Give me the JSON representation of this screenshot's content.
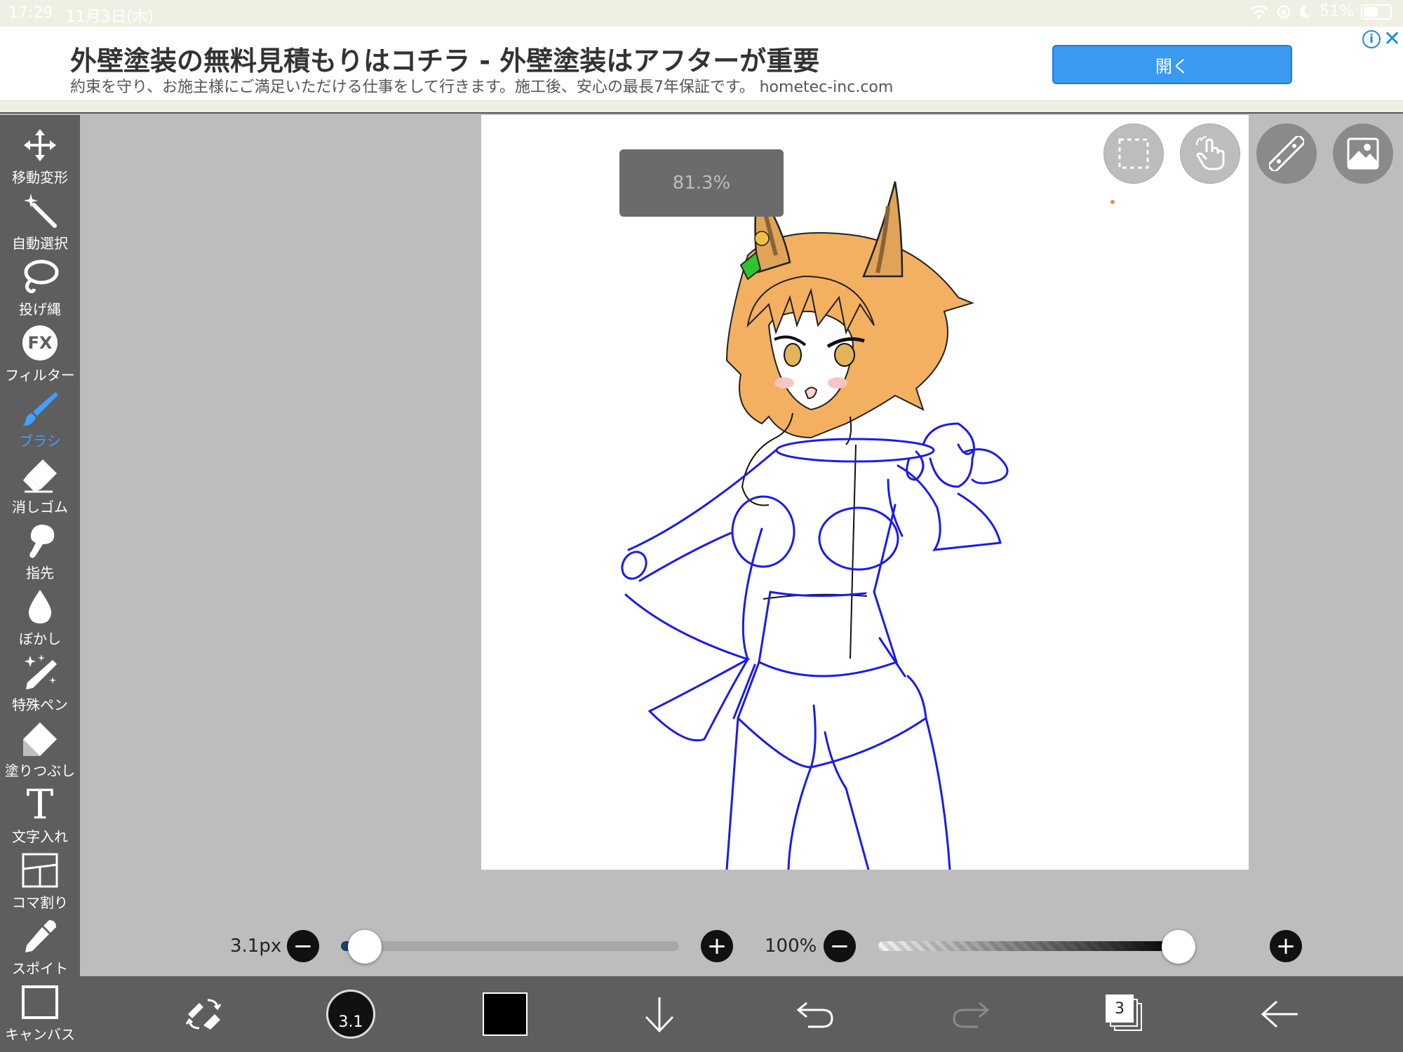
{
  "status_bar": {
    "time": "17:29",
    "date": "11月3日(木)",
    "battery": "51%"
  },
  "ad": {
    "headline": "外壁塗装の無料見積もりはコチラ - 外壁塗装はアフターが重要",
    "description": "約束を守り、お施主様にご満足いただける仕事をして行きます。施工後、安心の最長7年保証です。 hometec-inc.com",
    "open_button": "開く",
    "info_icon": "i",
    "close_icon": "✕"
  },
  "toolbar": {
    "items": [
      {
        "label": "移動変形",
        "icon": "move-icon"
      },
      {
        "label": "自動選択",
        "icon": "magic-wand-icon"
      },
      {
        "label": "投げ縄",
        "icon": "lasso-icon"
      },
      {
        "label": "フィルター",
        "icon": "fx-icon",
        "icon_text": "FX"
      },
      {
        "label": "ブラシ",
        "icon": "brush-icon",
        "active": true
      },
      {
        "label": "消しゴム",
        "icon": "eraser-icon"
      },
      {
        "label": "指先",
        "icon": "finger-icon"
      },
      {
        "label": "ぼかし",
        "icon": "blur-drop-icon"
      },
      {
        "label": "特殊ペン",
        "icon": "special-pen-icon"
      },
      {
        "label": "塗りつぶし",
        "icon": "fill-bucket-icon"
      },
      {
        "label": "文字入れ",
        "icon": "text-icon",
        "icon_text": "T"
      },
      {
        "label": "コマ割り",
        "icon": "frame-divider-icon"
      },
      {
        "label": "スポイト",
        "icon": "eyedropper-icon"
      },
      {
        "label": "キャンバス",
        "icon": "canvas-icon"
      }
    ]
  },
  "canvas": {
    "zoom": "81.3%"
  },
  "brush": {
    "size_label": "3.1px",
    "size_fraction": 0.07,
    "opacity_label": "100%",
    "opacity_fraction": 1.0
  },
  "bottom_bar": {
    "brush_size_preview": "3.1",
    "layers_count": "3"
  },
  "colors": {
    "accent": "#3fa0ff",
    "toolbar_bg": "#5e5e5e",
    "sketch_blue": "#1a1aef",
    "hair": "#f2b060"
  }
}
